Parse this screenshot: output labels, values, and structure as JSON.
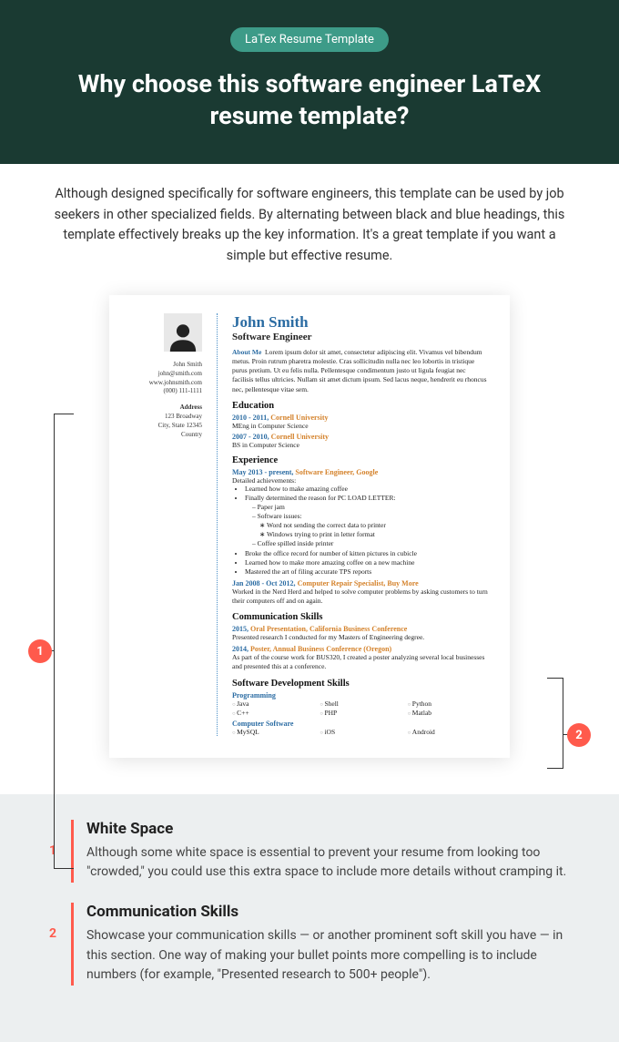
{
  "hero": {
    "pill": "LaTex Resume Template",
    "title": "Why choose this software engineer LaTeX resume template?"
  },
  "intro": "Although designed specifically for software engineers, this template can be used by job seekers in other specialized fields. By alternating between black and blue headings, this template effectively breaks up the key information. It's a great template if you want a simple but effective resume.",
  "callouts": {
    "c1": "1",
    "c2": "2"
  },
  "resume": {
    "side": {
      "name": "John Smith",
      "email": "john@smith.com",
      "web": "www.johnsmith.com",
      "phone": "(000) 111-1111",
      "addr_label": "Address",
      "addr1": "123 Broadway",
      "addr2": "City, State 12345",
      "addr3": "Country"
    },
    "name": "John Smith",
    "role": "Software Engineer",
    "about_label": "About Me",
    "about": "Lorem ipsum dolor sit amet, consectetur adipiscing elit. Vivamus vel bibendum metus. Proin rutrum pharetra molestie. Cras sollicitudin nulla nec leo lobortis in tristique purus pretium. Ut eu felis nulla. Pellentesque condimentum justo ut ligula feugiat nec facilisis tellus ultricies. Nullam sit amet dictum ipsum. Sed lacus neque, hendrerit eu rhoncus nec, pellentesque vitae sem.",
    "edu_label": "Education",
    "edu1_date": "2010 - 2011, ",
    "edu1_school": "Cornell University",
    "edu1_deg": "MEng in Computer Science",
    "edu2_date": "2007 - 2010, ",
    "edu2_school": "Cornell University",
    "edu2_deg": "BS in Computer Science",
    "exp_label": "Experience",
    "exp1_date": "May 2013 - present, ",
    "exp1_title": "Software Engineer",
    "exp1_company": "Google",
    "exp1_sub": "Detailed achievements:",
    "exp1_bullets": {
      "b1": "Learned how to make amazing coffee",
      "b2": "Finally determined the reason for PC LOAD LETTER:",
      "b2a": "Paper jam",
      "b2b": "Software issues:",
      "b2b1": "Word not sending the correct data to printer",
      "b2b2": "Windows trying to print in letter format",
      "b2c": "Coffee spilled inside printer",
      "b3": "Broke the office record for number of kitten pictures in cubicle",
      "b4": "Learned how to make more amazing coffee on a new machine",
      "b5": "Mastered the art of filing accurate TPS reports"
    },
    "exp2_date": "Jan 2008 - Oct 2012, ",
    "exp2_title": "Computer Repair Specialist",
    "exp2_company": "Buy More",
    "exp2_desc": "Worked in the Nerd Herd and helped to solve computer problems by asking customers to turn their computers off and on again.",
    "comm_label": "Communication Skills",
    "comm1_date": "2015, ",
    "comm1_title": "Oral Presentation",
    "comm1_venue": "California Business Conference",
    "comm1_desc": "Presented research I conducted for my Masters of Engineering degree.",
    "comm2_date": "2014, ",
    "comm2_title": "Poster",
    "comm2_venue": "Annual Business Conference (Oregon)",
    "comm2_desc": "As part of the course work for BUS320, I created a poster analyzing several local businesses and presented this at a conference.",
    "dev_label": "Software Development Skills",
    "prog_label": "Programming",
    "prog": {
      "s1": "Java",
      "s2": "Shell",
      "s3": "Python",
      "s4": "C++",
      "s5": "PHP",
      "s6": "Matlab"
    },
    "cs_label": "Computer Software",
    "cs": {
      "s1": "MySQL",
      "s2": "iOS",
      "s3": "Android"
    }
  },
  "tips": {
    "t1": {
      "num": "1",
      "title": "White Space",
      "body": "Although some white space is essential to prevent your resume from looking too \"crowded,\" you could use this extra space to include more details without cramping it."
    },
    "t2": {
      "num": "2",
      "title": "Communication Skills",
      "body": "Showcase your communication skills — or another prominent soft skill you have — in this section. One way of making your bullet points more compelling is to include numbers (for example, \"Presented research to 500+ people\")."
    }
  }
}
